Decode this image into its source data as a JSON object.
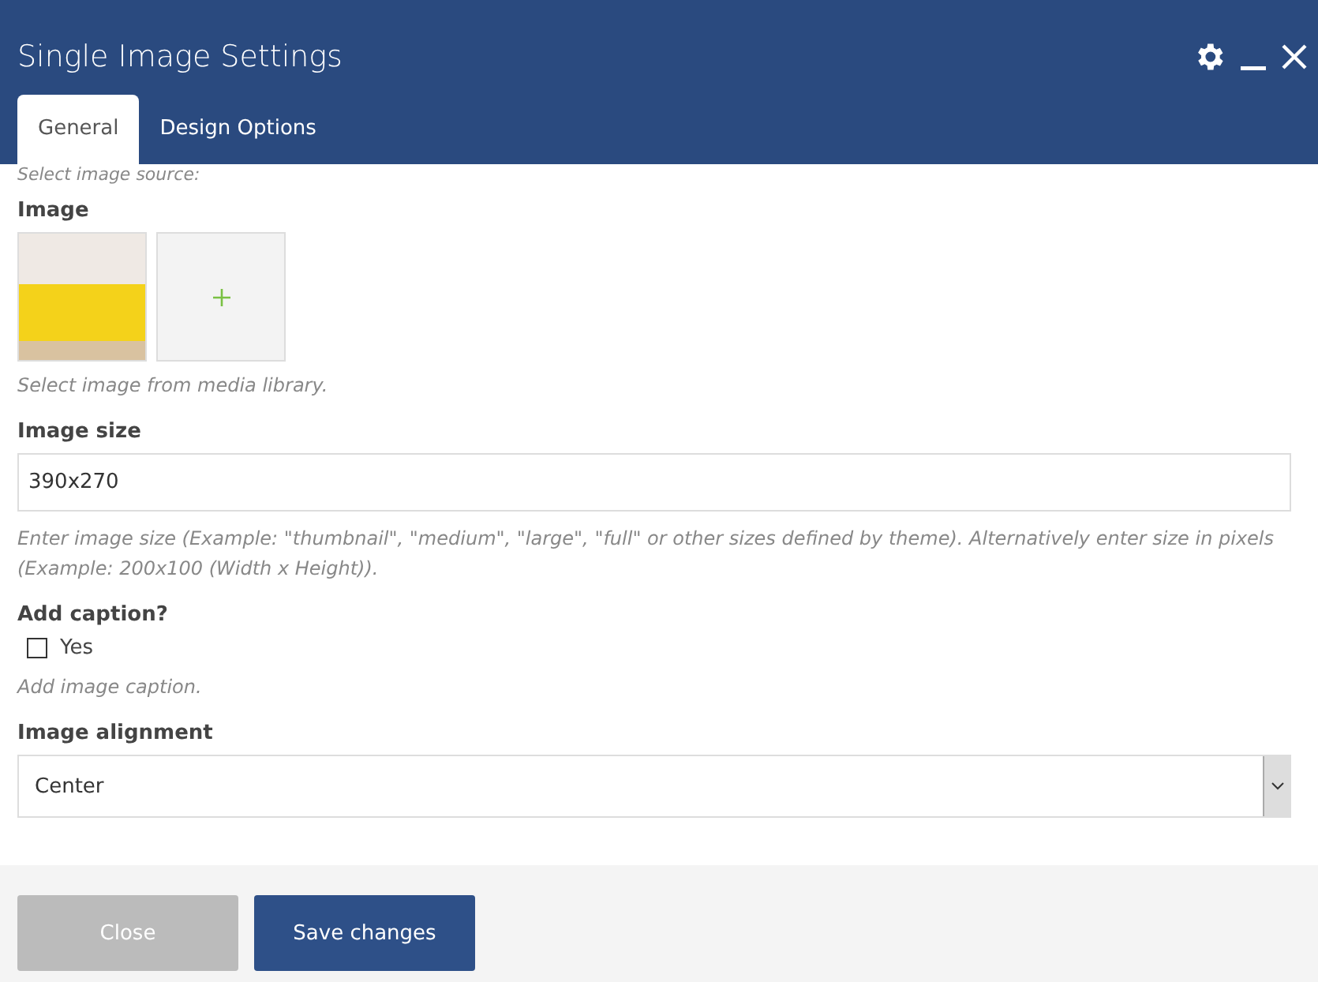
{
  "window": {
    "title": "Single Image Settings"
  },
  "tabs": [
    {
      "label": "General",
      "selected": true
    },
    {
      "label": "Design Options",
      "selected": false
    }
  ],
  "source_hint": "Select image source:",
  "image": {
    "label": "Image",
    "hint": "Select image from media library."
  },
  "image_size": {
    "label": "Image size",
    "value": "390x270",
    "hint": "Enter image size (Example: \"thumbnail\", \"medium\", \"large\", \"full\" or other sizes defined by theme). Alternatively enter size in pixels (Example: 200x100 (Width x Height))."
  },
  "caption": {
    "label": "Add caption?",
    "option": "Yes",
    "checked": false,
    "hint": "Add image caption."
  },
  "alignment": {
    "label": "Image alignment",
    "value": "Center"
  },
  "buttons": [
    {
      "label": "Close",
      "kind": "secondary"
    },
    {
      "label": "Save changes",
      "kind": "primary"
    }
  ]
}
